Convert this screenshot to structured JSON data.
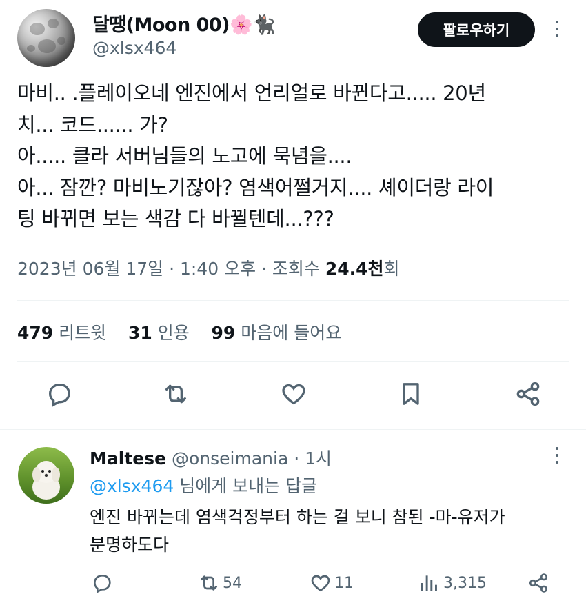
{
  "tweet": {
    "author_name": "달땡(Moon 00)🌸🐈‍⬛",
    "author_handle": "@xlsx464",
    "follow_label": "팔로우하기",
    "body": "마비.. .플레이오네 엔진에서 언리얼로 바뀐다고..... 20년\n치... 코드...... 가?\n아..... 클라 서버님들의 노고에 묵념을....\n아... 잠깐? 마비노기잖아? 염색어쩔거지.... 셰이더랑 라이\n팅 바뀌면 보는 색감 다 바뀔텐데...???",
    "date": "2023년 06월 17일 · 1:40 오후 · 조회수 ",
    "views": "24.4천",
    "views_suffix": "회",
    "stats": {
      "retweets": "479",
      "retweets_label": "리트윗",
      "quotes": "31",
      "quotes_label": "인용",
      "likes": "99",
      "likes_label": "마음에 들어요"
    }
  },
  "icons": [
    "more-icon",
    "reply-icon",
    "retweet-icon",
    "like-icon",
    "bookmark-icon",
    "share-icon",
    "views-icon"
  ],
  "reply": {
    "name": "Maltese",
    "handle_time": " @onseimania · 1시",
    "mention": "@xlsx464",
    "reply_to_suffix": " 님에게 보내는 답글",
    "text": "엔진 바뀌는데 염색걱정부터 하는 걸 보니 참된 -마-유저가\n분명하도다",
    "retweets": "54",
    "likes": "11",
    "views": "3,315"
  },
  "colors": {
    "accent": "#1d9bf0",
    "text": "#0f1419",
    "muted": "#536471",
    "divider": "#eff3f4"
  }
}
